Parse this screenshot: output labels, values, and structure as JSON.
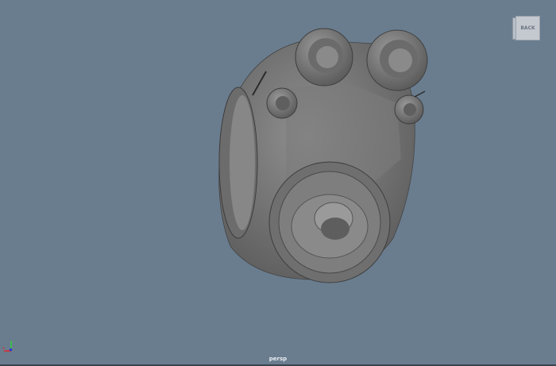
{
  "viewport": {
    "camera_label": "persp",
    "viewcube_face": "BACK",
    "background_color": "#6a7d8f",
    "axis_colors": {
      "x": "#e0262a",
      "y": "#2fcc3a",
      "z": "#2a35e0"
    },
    "axis_labels": {
      "x": "x",
      "y": "y"
    }
  }
}
